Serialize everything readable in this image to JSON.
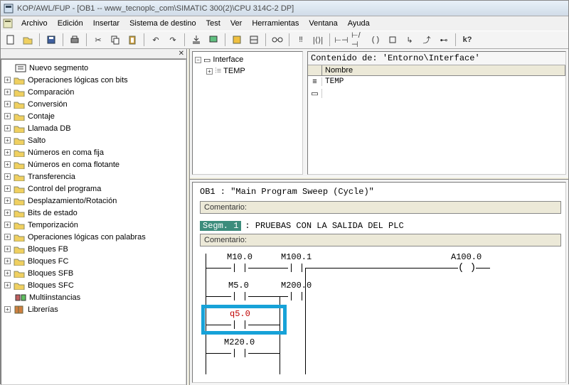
{
  "titlebar": {
    "text": "KOP/AWL/FUP  - [OB1 -- www_tecnoplc_com\\SIMATIC 300(2)\\CPU 314C-2 DP]"
  },
  "menu": {
    "items": [
      "Archivo",
      "Edición",
      "Insertar",
      "Sistema de destino",
      "Test",
      "Ver",
      "Herramientas",
      "Ventana",
      "Ayuda"
    ]
  },
  "tree": {
    "items": [
      {
        "icon": "segment",
        "label": "Nuevo segmento",
        "expand": ""
      },
      {
        "icon": "folder",
        "label": "Operaciones lógicas con bits",
        "expand": "+"
      },
      {
        "icon": "folder",
        "label": "Comparación",
        "expand": "+"
      },
      {
        "icon": "folder",
        "label": "Conversión",
        "expand": "+"
      },
      {
        "icon": "folder",
        "label": "Contaje",
        "expand": "+"
      },
      {
        "icon": "folder",
        "label": "Llamada DB",
        "expand": "+"
      },
      {
        "icon": "folder",
        "label": "Salto",
        "expand": "+"
      },
      {
        "icon": "folder",
        "label": "Números en coma fija",
        "expand": "+"
      },
      {
        "icon": "folder",
        "label": "Números en coma flotante",
        "expand": "+"
      },
      {
        "icon": "folder",
        "label": "Transferencia",
        "expand": "+"
      },
      {
        "icon": "folder",
        "label": "Control del programa",
        "expand": "+"
      },
      {
        "icon": "folder",
        "label": "Desplazamiento/Rotación",
        "expand": "+"
      },
      {
        "icon": "folder",
        "label": "Bits de estado",
        "expand": "+"
      },
      {
        "icon": "folder",
        "label": "Temporización",
        "expand": "+"
      },
      {
        "icon": "folder",
        "label": "Operaciones lógicas con palabras",
        "expand": "+"
      },
      {
        "icon": "folder",
        "label": "Bloques FB",
        "expand": "+"
      },
      {
        "icon": "folder",
        "label": "Bloques FC",
        "expand": "+"
      },
      {
        "icon": "folder",
        "label": "Bloques SFB",
        "expand": "+"
      },
      {
        "icon": "folder",
        "label": "Bloques SFC",
        "expand": "+"
      },
      {
        "icon": "multi",
        "label": "Multiinstancias",
        "expand": ""
      },
      {
        "icon": "book",
        "label": "Librerías",
        "expand": "+"
      }
    ]
  },
  "iface": {
    "root": "Interface",
    "child": "TEMP",
    "contentTitle": "Contenido de: 'Entorno\\Interface'",
    "colName": "Nombre",
    "row1": "TEMP"
  },
  "editor": {
    "obLine": "OB1 :  \"Main Program Sweep (Cycle)\"",
    "comentario": "Comentario:",
    "segBadge": "Segm. 1",
    "segText": ": PRUEBAS CON LA SALIDA DEL PLC"
  },
  "ladder": {
    "r1c1": "M10.0",
    "r1c2": "M100.1",
    "r1coil": "A100.0",
    "r2c1": "M5.0",
    "r2c2": "M200.0",
    "r3c1": "q5.0",
    "r4c1": "M220.0"
  }
}
